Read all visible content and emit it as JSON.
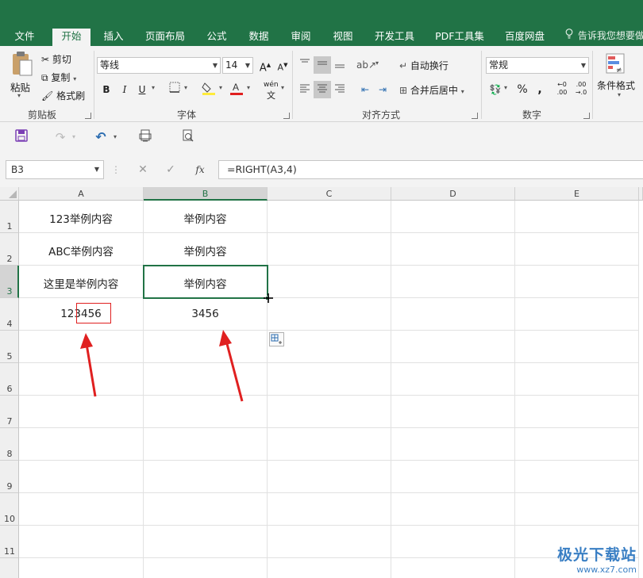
{
  "tabs": [
    {
      "label": "文件",
      "active": false
    },
    {
      "label": "开始",
      "active": true
    },
    {
      "label": "插入",
      "active": false
    },
    {
      "label": "页面布局",
      "active": false
    },
    {
      "label": "公式",
      "active": false
    },
    {
      "label": "数据",
      "active": false
    },
    {
      "label": "审阅",
      "active": false
    },
    {
      "label": "视图",
      "active": false
    },
    {
      "label": "开发工具",
      "active": false
    },
    {
      "label": "PDF工具集",
      "active": false
    },
    {
      "label": "百度网盘",
      "active": false
    }
  ],
  "tell_me": "告诉我您想要做",
  "ribbon": {
    "clipboard": {
      "paste": "粘贴",
      "cut": "剪切",
      "copy": "复制",
      "format_painter": "格式刷",
      "group": "剪贴板"
    },
    "font": {
      "name": "等线",
      "size": "14",
      "bold": "B",
      "italic": "I",
      "underline": "U",
      "grow": "A",
      "shrink": "A",
      "phonetic": "wén",
      "group": "字体"
    },
    "alignment": {
      "wrap": "自动换行",
      "merge": "合并后居中",
      "group": "对齐方式"
    },
    "number": {
      "format": "常规",
      "percent": "%",
      "comma": ",",
      "group": "数字"
    },
    "styles": {
      "conditional": "条件格式"
    }
  },
  "name_box": "B3",
  "formula": "=RIGHT(A3,4)",
  "columns": [
    "A",
    "B",
    "C",
    "D",
    "E"
  ],
  "rows": [
    "1",
    "2",
    "3",
    "4",
    "5",
    "6",
    "7",
    "8",
    "9",
    "10",
    "11"
  ],
  "cells": {
    "A1": "123举例内容",
    "B1": "举例内容",
    "A2": "ABC举例内容",
    "B2": "举例内容",
    "A3": "这里是举例内容",
    "B3": "举例内容",
    "A4": "123456",
    "B4": "3456"
  },
  "selected_cell": "B3",
  "watermark": {
    "line1": "极光下载站",
    "line2": "www.xz7.com"
  },
  "colors": {
    "accent": "#217346",
    "annotation": "#e02020"
  }
}
